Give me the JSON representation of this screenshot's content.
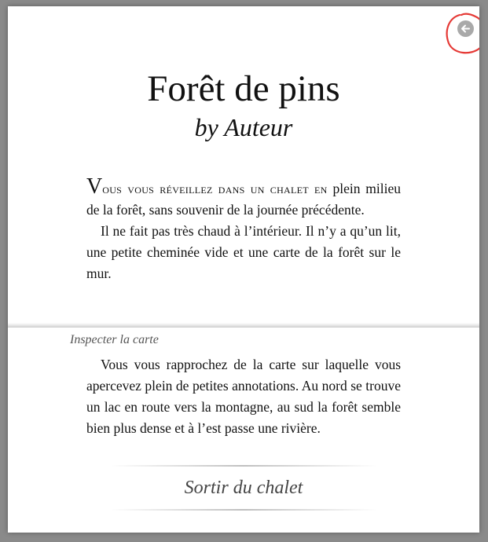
{
  "header": {
    "title": "Forêt de pins",
    "byline": "by Auteur"
  },
  "controls": {
    "rewind_icon": "arrow-left-circle-icon"
  },
  "passage_1": {
    "dropcap": "V",
    "smallcaps": "ous vous réveillez dans un chalet en",
    "rest": " plein milieu de la forêt, sans souvenir de la journée précédente.",
    "paragraph_2": "Il ne fait pas très chaud à l’intérieur. Il n’y a qu’un lit, une petite cheminée vide et une carte de la forêt sur le mur."
  },
  "chosen_option": "Inspecter la carte",
  "passage_2": {
    "paragraph_1": "Vous vous rapprochez de la carte sur laquelle vous apercevez plein de petites annotations. Au nord se trouve un lac en route vers la montagne, au sud la forêt semble bien plus dense et à l’est passe une rivière."
  },
  "choices": [
    {
      "label": "Sortir du chalet"
    }
  ],
  "colors": {
    "background": "#8a8a8a",
    "page": "#ffffff",
    "annotation_circle": "#e53935",
    "rewind_icon": "#a9a9a9"
  }
}
